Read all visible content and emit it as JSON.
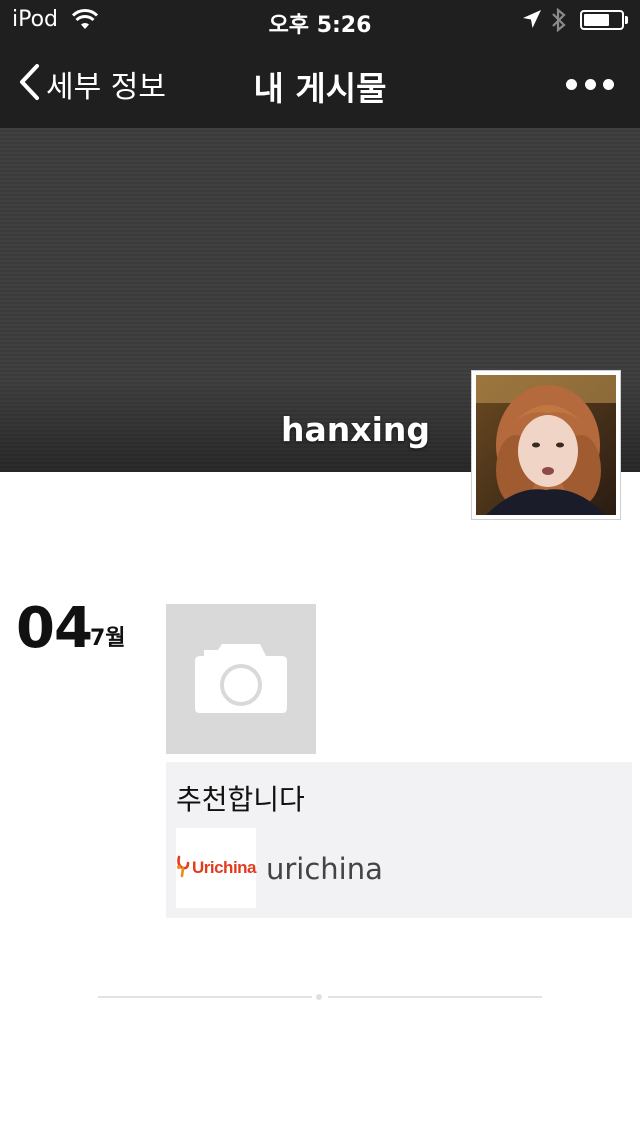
{
  "status_bar": {
    "carrier": "iPod",
    "time": "오후 5:26",
    "battery_level": 0.7
  },
  "nav": {
    "back_label": "세부 정보",
    "title": "내 게시물"
  },
  "profile": {
    "username": "hanxing"
  },
  "post": {
    "day": "04",
    "month": "7월",
    "text": "추천합니다",
    "link": {
      "logo_text": "Urichina",
      "title": "urichina"
    }
  },
  "colors": {
    "bar_background": "#1f1f1f",
    "cover": "#3d3d3d",
    "photo_placeholder": "#d9d9d9",
    "card_background": "#f2f2f4",
    "brand": "#e33b1f"
  },
  "icons": [
    "wifi-icon",
    "location-arrow-icon",
    "bluetooth-icon",
    "battery-icon",
    "back-chevron-icon",
    "more-icon",
    "camera-icon"
  ]
}
